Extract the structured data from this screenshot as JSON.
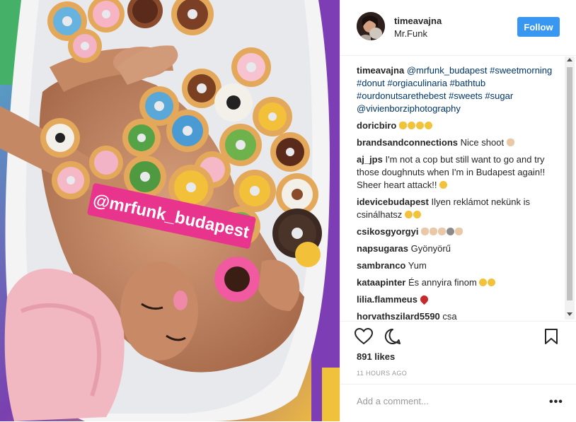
{
  "post": {
    "username": "timeavajna",
    "location": "Mr.Funk",
    "follow_label": "Follow",
    "photo_sticker": "@mrfunk_budapest"
  },
  "caption": {
    "user": "timeavajna",
    "mention": "@mrfunk_budapest",
    "hashtags": "#sweetmorning #donut #orgiaculinaria #bathtub #ourdonutsarethebest #sweets #sugar @vivienborziphotography"
  },
  "comments": [
    {
      "user": "doricbiro",
      "text": ""
    },
    {
      "user": "brandsandconnections",
      "text": "Nice shoot"
    },
    {
      "user": "aj_jps",
      "text": "I'm not a cop but still want to go and try those doughnuts when I'm in Budapest again!! Sheer heart attack!!"
    },
    {
      "user": "idevicebudapest",
      "text": "Ilyen reklámot nekünk is csinálhatsz"
    },
    {
      "user": "csikosgyorgyi",
      "text": ""
    },
    {
      "user": "napsugaras",
      "text": "Gyönyörű"
    },
    {
      "user": "sambranco",
      "text": "Yum"
    },
    {
      "user": "kataapinter",
      "text": "És annyira finom"
    },
    {
      "user": "lilia.flammeus",
      "text": ""
    },
    {
      "user": "horvathszilard5590",
      "text": "csa"
    }
  ],
  "actions": {
    "like_icon": "heart-icon",
    "comment_icon": "comment-bubble-icon",
    "save_icon": "bookmark-icon"
  },
  "likes": "891 likes",
  "timestamp": "11 HOURS AGO",
  "add_comment": {
    "placeholder": "Add a comment...",
    "more_label": "•••"
  },
  "colors": {
    "follow_bg": "#3897f0",
    "hashtag": "#003569",
    "sticker_pink": "#e8348d"
  }
}
